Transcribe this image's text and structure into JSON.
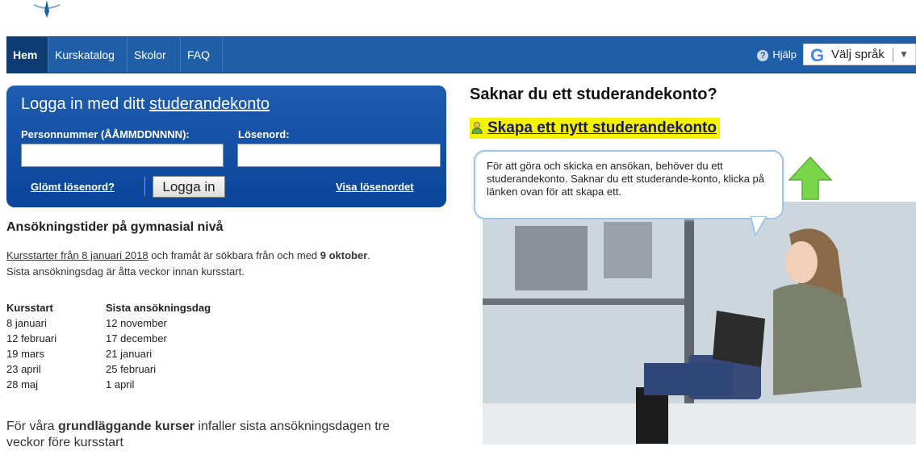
{
  "nav": {
    "items": [
      "Hem",
      "Kurskatalog",
      "Skolor",
      "FAQ"
    ],
    "help_label": "Hjälp",
    "language_label": "Välj språk",
    "language_arrow": "▼",
    "google_letter": "G"
  },
  "login": {
    "title_prefix": "Logga in med ditt ",
    "title_link": "studerandekonto",
    "personnummer_label": "Personnummer (ÅÅMMDDNNNN):",
    "password_label": "Lösenord:",
    "personnummer_value": "",
    "password_value": "",
    "forgot_link": "Glömt lösenord?",
    "login_button": "Logga in",
    "show_password_link": "Visa lösenordet"
  },
  "info": {
    "heading": "Ansökningstider på gymnasial nivå",
    "p1_link": "Kursstarter från 8 januari 2018",
    "p1_mid": " och framåt är sökbara från och med ",
    "p1_bold": "9 oktober",
    "p1_end": ".",
    "p1_line2": "Sista ansökningsdag är åtta veckor innan kursstart.",
    "table_headers": [
      "Kursstart",
      "Sista ansökningsdag"
    ],
    "table_rows": [
      [
        "8 januari",
        "12 november"
      ],
      [
        "12 februari",
        "17 december"
      ],
      [
        "19 mars",
        "21 januari"
      ],
      [
        "23 april",
        "25 februari"
      ],
      [
        "28 maj",
        "1 april"
      ]
    ],
    "p2_start": "För våra ",
    "p2_bold": "grundläggande kurser",
    "p2_end": " infaller sista ansökningsdagen tre",
    "p2_line2": "veckor före kursstart"
  },
  "account": {
    "heading": "Saknar du ett studerandekonto?",
    "create_link": "Skapa ett nytt studerandekonto",
    "bubble_text": "För att göra och skicka en ansökan, behöver du ett studerandekonto. Saknar du ett studerande-konto, klicka på länken  ovan  för att skapa ett."
  },
  "colors": {
    "nav_bg": "#1f5fa8",
    "login_bg": "#0b449a",
    "highlight": "#f5f200"
  }
}
